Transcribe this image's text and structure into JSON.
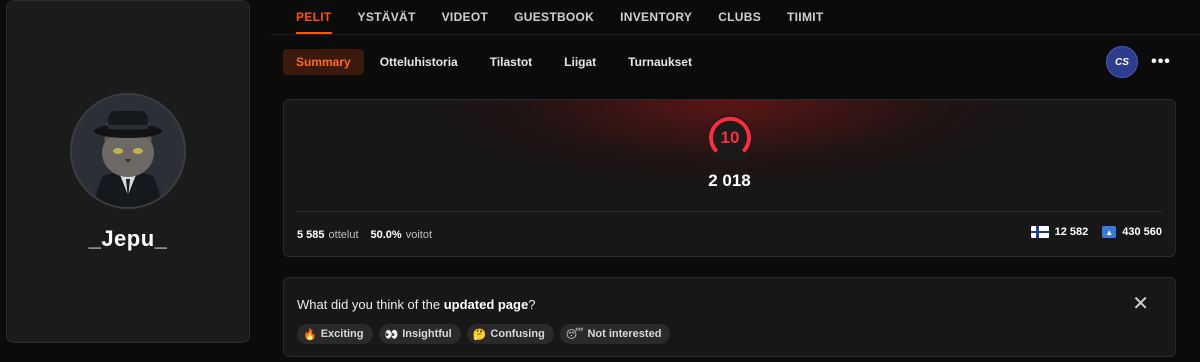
{
  "profile": {
    "username": "_Jepu_"
  },
  "top_nav": [
    {
      "label": "PELIT",
      "active": true
    },
    {
      "label": "YSTÄVÄT",
      "active": false
    },
    {
      "label": "VIDEOT",
      "active": false
    },
    {
      "label": "GUESTBOOK",
      "active": false
    },
    {
      "label": "INVENTORY",
      "active": false
    },
    {
      "label": "CLUBS",
      "active": false
    },
    {
      "label": "TIIMIT",
      "active": false
    }
  ],
  "sub_tabs": [
    {
      "label": "Summary",
      "active": true
    },
    {
      "label": "Otteluhistoria",
      "active": false
    },
    {
      "label": "Tilastot",
      "active": false
    },
    {
      "label": "Liigat",
      "active": false
    },
    {
      "label": "Turnaukset",
      "active": false
    }
  ],
  "game_actions": {
    "game_logo_text": "CS",
    "more_label": "•••"
  },
  "stats": {
    "level": "10",
    "elo": "2 018",
    "matches_value": "5 585",
    "matches_label": "ottelut",
    "winrate_value": "50.0%",
    "winrate_label": "voitot",
    "country_rank": "12 582",
    "region_rank": "430 560"
  },
  "feedback": {
    "question_prefix": "What did you think of the ",
    "question_bold": "updated page",
    "question_suffix": "?",
    "close_label": "✕",
    "options": [
      {
        "emoji": "🔥",
        "label": "Exciting"
      },
      {
        "emoji": "👀",
        "label": "Insightful"
      },
      {
        "emoji": "🤔",
        "label": "Confusing"
      },
      {
        "emoji": "😴",
        "label": "Not interested"
      }
    ]
  },
  "colors": {
    "accent": "#ff5500",
    "level_red": "#ff2b3a",
    "background": "#0b0b0b",
    "panel": "#171717"
  }
}
